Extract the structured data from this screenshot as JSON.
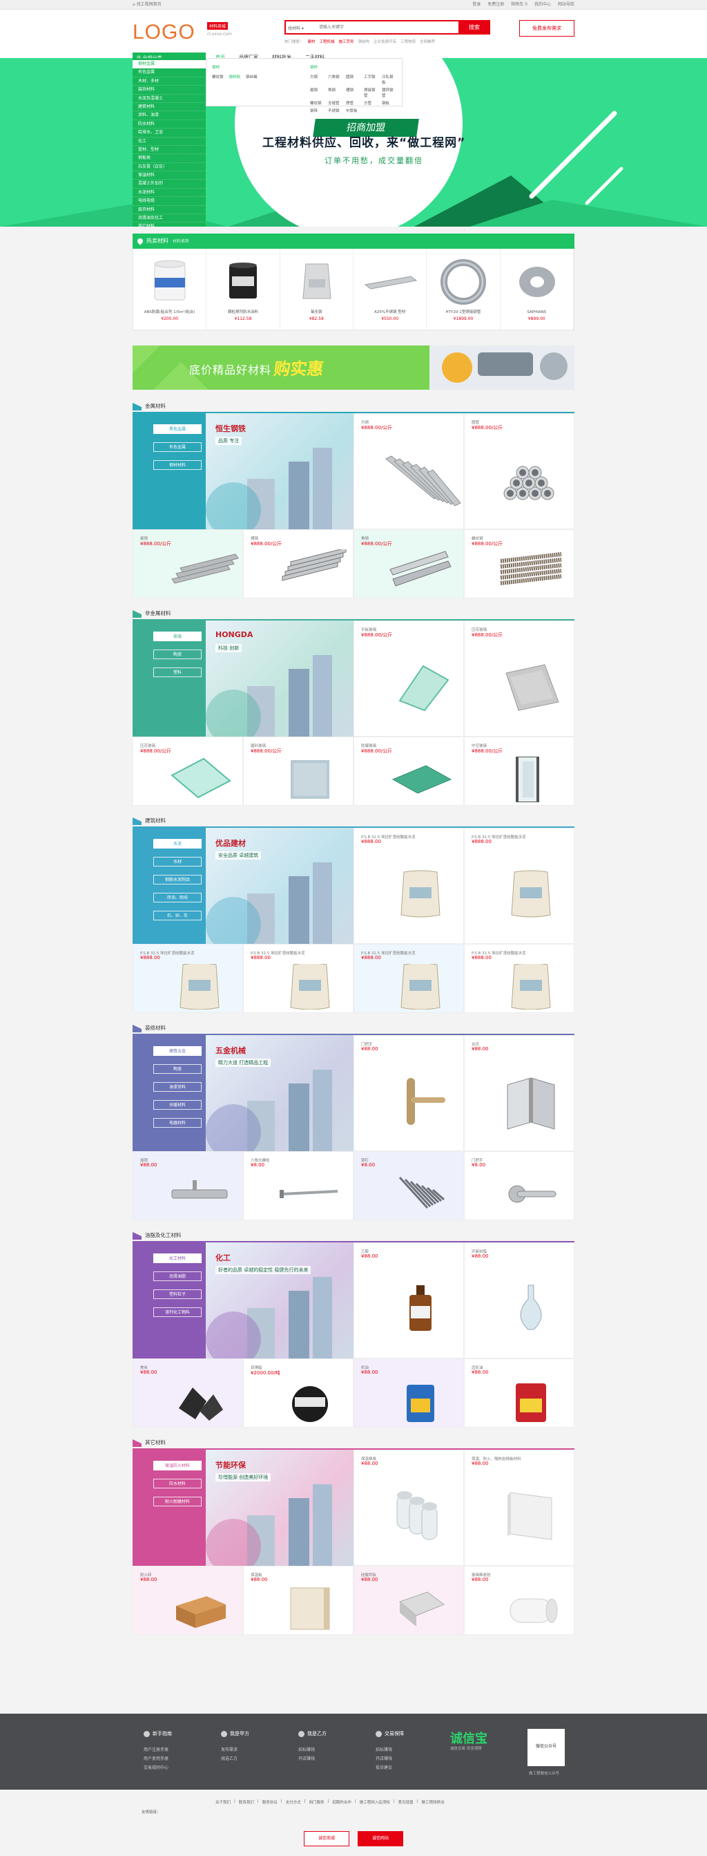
{
  "topbar": {
    "home": "找工程网首页",
    "links": [
      "登录",
      "免费注册",
      "购物车 0",
      "我的中心",
      "网站导航"
    ]
  },
  "header": {
    "logo": "LOGO",
    "site_tag": "材料商城",
    "site_url": "cl.xxxx.com",
    "search_type": "找材料",
    "search_placeholder": "请输入关键字",
    "search_btn": "搜索",
    "hot_label": "热门搜索：",
    "hot_links": [
      "建材",
      "工程机械",
      "施工劳务",
      "钢结构",
      "企业免费开店",
      "工程物资",
      "全网推荐"
    ],
    "publish": "免费发布需求"
  },
  "nav": {
    "cat": "全部分类",
    "items": [
      "首页",
      "品牌厂家",
      "材料批发",
      "二手材料"
    ]
  },
  "sidebar": [
    "钢材金属",
    "有色金属",
    "木材、多材",
    "装饰材料",
    "水泥及混凝土",
    "建筑材料",
    "涂料、油漆",
    "防水材料",
    "给排水、卫浴",
    "化工",
    "管材、型材",
    "钢板类",
    "石灰膏（白灰）",
    "保温材料",
    "混凝土外加剂",
    "水泥材料",
    "电线电缆",
    "废弃材料",
    "润滑油及化工",
    "其它材料"
  ],
  "submenu": {
    "col1_title": "钢材",
    "col1": [
      "螺纹钢",
      "钢材网",
      "钢丝绳"
    ],
    "col2_title": "钢材",
    "col2": [
      "方钢",
      "六角钢",
      "圆钢",
      "工字钢",
      "冷轧钢板",
      "扁钢",
      "角钢",
      "槽钢",
      "焊接钢管",
      "镀锌钢管",
      "螺纹钢",
      "无缝管",
      "焊管",
      "方管",
      "钢板",
      "钢带",
      "不锈钢",
      "中厚板"
    ]
  },
  "banner": {
    "tag": "招商加盟",
    "title": "工程材料供应、回收，来“做工程网”",
    "subtitle": "订单不用愁，成交量翻倍"
  },
  "hot": {
    "title": "热卖材料",
    "sub": "材料推荐",
    "items": [
      {
        "name": "ABS防腐(粘合剂 1/5m²/粘合)",
        "price": "¥200.00"
      },
      {
        "name": "颗粒焊剂防水涂料",
        "price": "¥112.58"
      },
      {
        "name": "氧化铁",
        "price": "¥82.58"
      },
      {
        "name": "A25%不锈钢 型材",
        "price": "¥550.00"
      },
      {
        "name": "HTY20-1型焊接钢管",
        "price": "¥1899.00"
      },
      {
        "name": "SAPHIANS",
        "price": "¥899.00"
      }
    ]
  },
  "ad": {
    "t1": "底价精品好材料",
    "t2": "购实惠"
  },
  "floors": [
    {
      "title": "金属材料",
      "color": "#2aa7b9",
      "bg2": "#e9f9f3",
      "tags": [
        "黑色金属",
        "有色金属",
        "钢材材料"
      ],
      "brand": "恒生钢铁",
      "slogan": "品质 专注",
      "items": [
        {
          "name": "方钢",
          "price": "¥888.00/公斤",
          "img": "steel-bars"
        },
        {
          "name": "圆管",
          "price": "¥888.00/公斤",
          "img": "steel-pipes"
        },
        {
          "name": "扁钢",
          "price": "¥888.00/公斤",
          "img": "flat-steel"
        },
        {
          "name": "槽钢",
          "price": "¥888.00/公斤",
          "img": "channel-steel"
        },
        {
          "name": "角钢",
          "price": "¥888.00/公斤",
          "img": "angle-steel"
        },
        {
          "name": "螺纹钢",
          "price": "¥888.00/公斤",
          "img": "rebar"
        }
      ]
    },
    {
      "title": "非金属材料",
      "color": "#3dae94",
      "bg2": "#ffffff",
      "tags": [
        "玻璃",
        "陶瓷",
        "塑料"
      ],
      "brand": "HONGDA",
      "slogan": "科技 创新",
      "items": [
        {
          "name": "平板玻璃",
          "price": "¥888.00/公斤",
          "img": "glass"
        },
        {
          "name": "压花玻璃",
          "price": "¥888.00/公斤",
          "img": "pattern-glass"
        },
        {
          "name": "压花玻璃",
          "price": "¥888.00/公斤",
          "img": "flat-glass"
        },
        {
          "name": "磨砂玻璃",
          "price": "¥888.00/公斤",
          "img": "frosted-glass"
        },
        {
          "name": "防爆玻璃",
          "price": "¥888.00/公斤",
          "img": "tempered-glass"
        },
        {
          "name": "中空玻璃",
          "price": "¥888.00/公斤",
          "img": "insulated-glass"
        }
      ]
    },
    {
      "title": "建筑材料",
      "color": "#3aa6c8",
      "bg2": "#eef7fd",
      "tags": [
        "水泥",
        "水材",
        "钢筋水泥制品",
        "砖块、砌块",
        "石、砂、灰"
      ],
      "brand": "优品建材",
      "slogan": "安全品质 卓越建筑",
      "items": [
        {
          "name": "P.S.B 32.5 埃拉矿渣硅酸盐水泥",
          "price": "¥888.00",
          "img": "cement"
        },
        {
          "name": "P.S.B 32.5 埃拉矿渣硅酸盐水泥",
          "price": "¥888.00",
          "img": "cement"
        },
        {
          "name": "P.S.B 32.5 埃拉矿渣硅酸盐水泥",
          "price": "¥888.00",
          "img": "cement"
        },
        {
          "name": "P.S.B 32.5 埃拉矿渣硅酸盐水泥",
          "price": "¥888.00",
          "img": "cement"
        },
        {
          "name": "P.S.B 32.5 埃拉矿渣硅酸盐水泥",
          "price": "¥888.00",
          "img": "cement"
        },
        {
          "name": "P.S.B 32.5 埃拉矿渣硅酸盐水泥",
          "price": "¥888.00",
          "img": "cement"
        }
      ]
    },
    {
      "title": "装修材料",
      "color": "#6a73b6",
      "bg2": "#eef0fb",
      "tags": [
        "建筑五金",
        "陶瓷",
        "油漆涂料",
        "水暖材料",
        "电器材料"
      ],
      "brand": "五金机械",
      "slogan": "精力大道 打造精品工程",
      "items": [
        {
          "name": "门把手",
          "price": "¥88.00",
          "img": "door-handle"
        },
        {
          "name": "合页",
          "price": "¥88.00",
          "img": "hinge"
        },
        {
          "name": "插销",
          "price": "¥88.00",
          "img": "bolt"
        },
        {
          "name": "六角头螺栓",
          "price": "¥8.00",
          "img": "screw"
        },
        {
          "name": "铆钉",
          "price": "¥8.00",
          "img": "rivets"
        },
        {
          "name": "门把手",
          "price": "¥8.00",
          "img": "lever-handle"
        }
      ]
    },
    {
      "title": "油脂及化工材料",
      "color": "#8a58b5",
      "bg2": "#f4edfb",
      "tags": [
        "化工材料",
        "润滑油脂",
        "塑料粒子",
        "溶剂化工物料"
      ],
      "brand": "化工",
      "slogan": "好者的品质 卓越的稳定性 稳健先行的未来",
      "items": [
        {
          "name": "乙醇",
          "price": "¥88.00",
          "img": "bottle"
        },
        {
          "name": "环氧树脂",
          "price": "¥88.00",
          "img": "flask"
        },
        {
          "name": "焦炭",
          "price": "¥88.00",
          "img": "coal"
        },
        {
          "name": "润滑脂",
          "price": "¥2000.00/吨",
          "img": "grease"
        },
        {
          "name": "机油",
          "price": "¥88.00",
          "img": "oil-can"
        },
        {
          "name": "齿轮油",
          "price": "¥88.00",
          "img": "red-can"
        }
      ]
    },
    {
      "title": "其它材料",
      "color": "#d04f96",
      "bg2": "#fbeef6",
      "tags": [
        "保温防火材料",
        "防水材料",
        "耐火耐磨材料"
      ],
      "brand": "节能环保",
      "slogan": "珍惜能源 创造美好环境",
      "items": [
        {
          "name": "保温棉卷",
          "price": "¥88.00",
          "img": "rolls"
        },
        {
          "name": "保温、防火、隔热岩棉板材料",
          "price": "¥88.00",
          "img": "panel"
        },
        {
          "name": "耐火砖",
          "price": "¥88.00",
          "img": "brick"
        },
        {
          "name": "保温板",
          "price": "¥88.00",
          "img": "board"
        },
        {
          "name": "硅酸钙板",
          "price": "¥88.00",
          "img": "tiles"
        },
        {
          "name": "玻璃棉卷毡",
          "price": "¥88.00",
          "img": "roll-white"
        }
      ]
    }
  ],
  "footer": {
    "cols": [
      {
        "title": "新手指南",
        "links": [
          "用户注册手册",
          "用户使用手册",
          "交易规则中心"
        ]
      },
      {
        "title": "我是甲方",
        "links": [
          "发布需求",
          "挑选乙方"
        ]
      },
      {
        "title": "我是乙方",
        "links": [
          "招标赚钱",
          "开店赚钱"
        ]
      },
      {
        "title": "交易保障",
        "links": [
          "招标赚钱",
          "开店赚钱",
          "投诉建议"
        ]
      }
    ],
    "brand": "诚信宝",
    "brand_sub": "诚信交易 安全保障",
    "qr": "微信公众号",
    "qr_caption": "做工程微信公众号",
    "links": [
      "关于我们",
      "联系我们",
      "服务协议",
      "支付方式",
      "网门服务",
      "招聘的合作",
      "做工程网入驻须知",
      "意见增值",
      "做工程网移动"
    ],
    "friend": "友情链接：",
    "badges": [
      "诚信商城",
      "诚信网站"
    ]
  }
}
